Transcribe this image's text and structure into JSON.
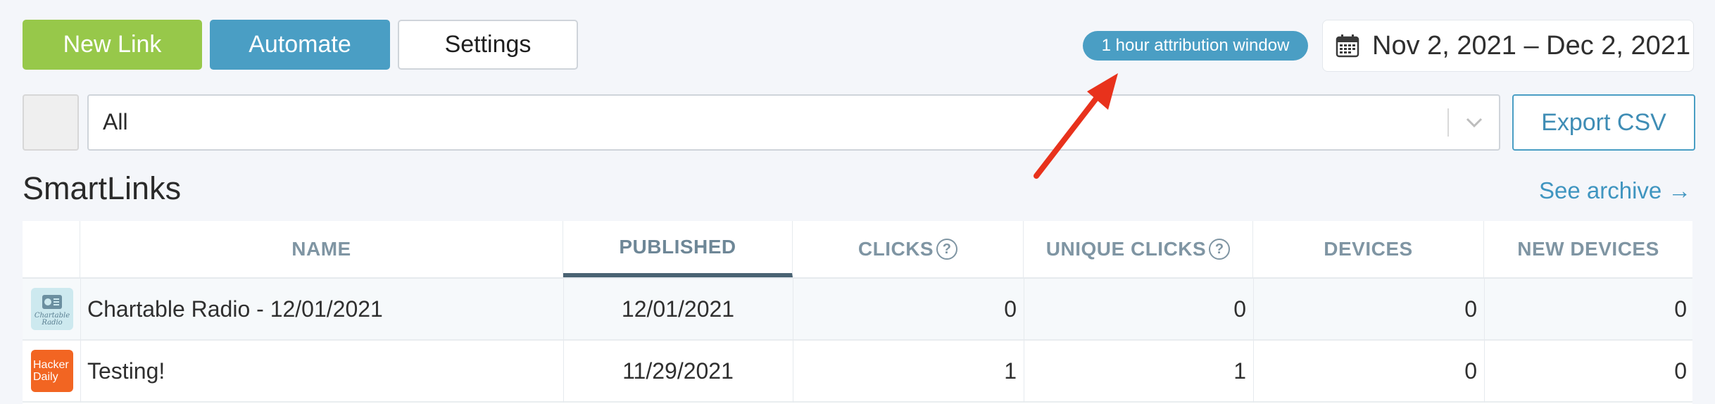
{
  "toolbar": {
    "new_link_label": "New Link",
    "automate_label": "Automate",
    "settings_label": "Settings",
    "attribution_label": "1 hour attribution window",
    "date_range_label": "Nov 2, 2021 – Dec 2, 2021",
    "calendar_icon": "calendar-icon"
  },
  "filter": {
    "selected_value": "All",
    "chevron_icon": "chevron-down-icon",
    "export_label": "Export CSV"
  },
  "section": {
    "title": "SmartLinks",
    "archive_link": "See archive →"
  },
  "table": {
    "columns": [
      "NAME",
      "PUBLISHED",
      "CLICKS",
      "UNIQUE CLICKS",
      "DEVICES",
      "NEW DEVICES"
    ],
    "help_symbol": "?",
    "sorted_column": "PUBLISHED",
    "rows": [
      {
        "thumbnail": "Chartable Radio",
        "name": "Chartable Radio - 12/01/2021",
        "published": "12/01/2021",
        "clicks": "0",
        "unique_clicks": "0",
        "devices": "0",
        "new_devices": "0"
      },
      {
        "thumbnail": "Hacker Daily",
        "name": "Testing!",
        "published": "11/29/2021",
        "clicks": "1",
        "unique_clicks": "1",
        "devices": "0",
        "new_devices": "0"
      }
    ]
  },
  "colors": {
    "green": "#97c84a",
    "blue": "#4a9ec4",
    "annotation_arrow": "#e8321c"
  }
}
